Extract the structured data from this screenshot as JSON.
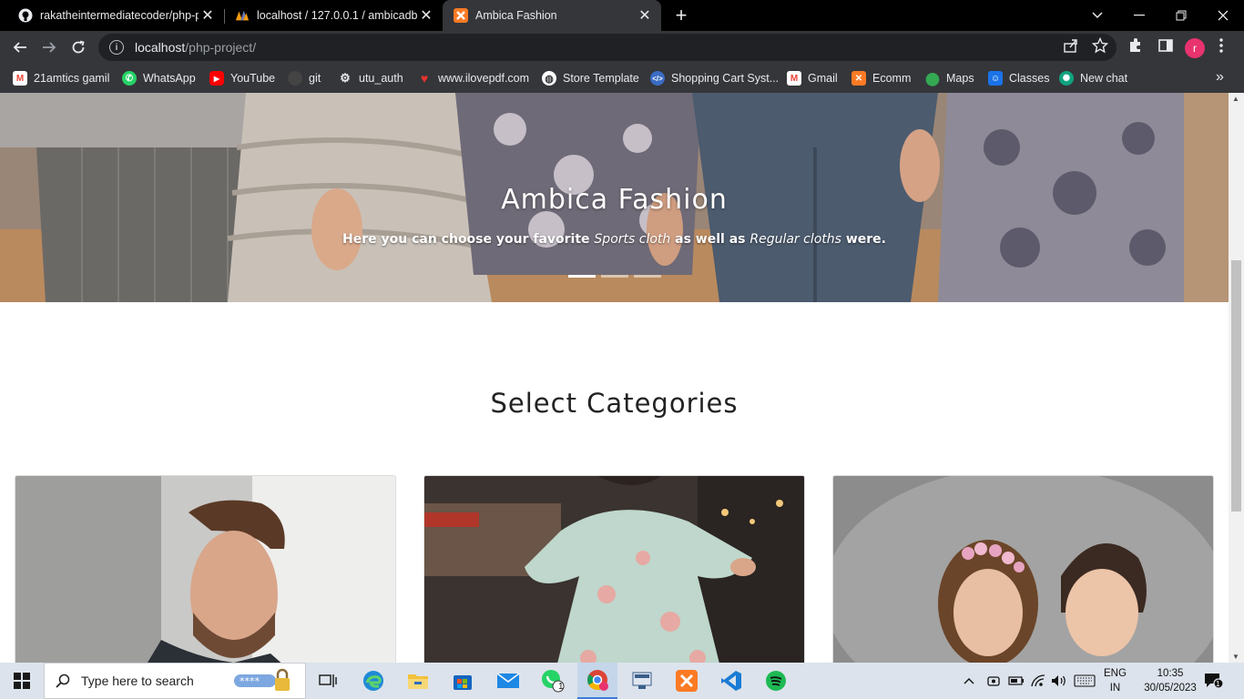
{
  "tabs": [
    {
      "title": "rakatheintermediatecoder/php-p",
      "icon": "github-icon"
    },
    {
      "title": "localhost / 127.0.0.1 / ambicadb /",
      "icon": "phpmyadmin-icon"
    },
    {
      "title": "Ambica Fashion",
      "icon": "xampp-icon"
    }
  ],
  "toolbar": {
    "url_host": "localhost",
    "url_path": "/php-project/",
    "profile_initial": "r"
  },
  "bookmarks": [
    {
      "label": "21amtics gamil",
      "icon": "gmail-icon",
      "color": "#ea4335"
    },
    {
      "label": "WhatsApp",
      "icon": "whatsapp-icon",
      "color": "#25d366"
    },
    {
      "label": "YouTube",
      "icon": "youtube-icon",
      "color": "#ff0000"
    },
    {
      "label": "git",
      "icon": "github-icon",
      "color": "#444444"
    },
    {
      "label": "utu_auth",
      "icon": "gear-icon",
      "color": "#35363a"
    },
    {
      "label": "www.ilovepdf.com",
      "icon": "heart-icon",
      "color": "#e5322d"
    },
    {
      "label": "Store Template",
      "icon": "globe-icon",
      "color": "#ffffff"
    },
    {
      "label": "Shopping Cart Syst...",
      "icon": "code-icon",
      "color": "#3b6cc4"
    },
    {
      "label": "Gmail",
      "icon": "gmail-icon",
      "color": "#ea4335"
    },
    {
      "label": "Ecomm",
      "icon": "xampp-icon",
      "color": "#fb7a24"
    },
    {
      "label": "Maps",
      "icon": "maps-icon",
      "color": "#34a853"
    },
    {
      "label": "Classes",
      "icon": "classroom-icon",
      "color": "#1e8e3e"
    },
    {
      "label": "New chat",
      "icon": "chatgpt-icon",
      "color": "#10a37f"
    }
  ],
  "hero": {
    "title": "Ambica Fashion",
    "sub_part1": "Here you can choose your favorite",
    "sub_em1": "Sports cloth",
    "sub_part2": "as well as",
    "sub_em2": "Regular cloths",
    "sub_part3": "were.",
    "slides": 3,
    "active_slide": 1
  },
  "section": {
    "title": "Select Categories"
  },
  "categories": [
    {
      "name": "men-category-card"
    },
    {
      "name": "women-category-card"
    },
    {
      "name": "kids-category-card"
    }
  ],
  "taskbar": {
    "search_placeholder": "Type here to search",
    "whatsapp_badge": "1",
    "language": "ENG",
    "region": "IN",
    "time": "10:35",
    "date": "30/05/2023",
    "notification_count": "1"
  }
}
